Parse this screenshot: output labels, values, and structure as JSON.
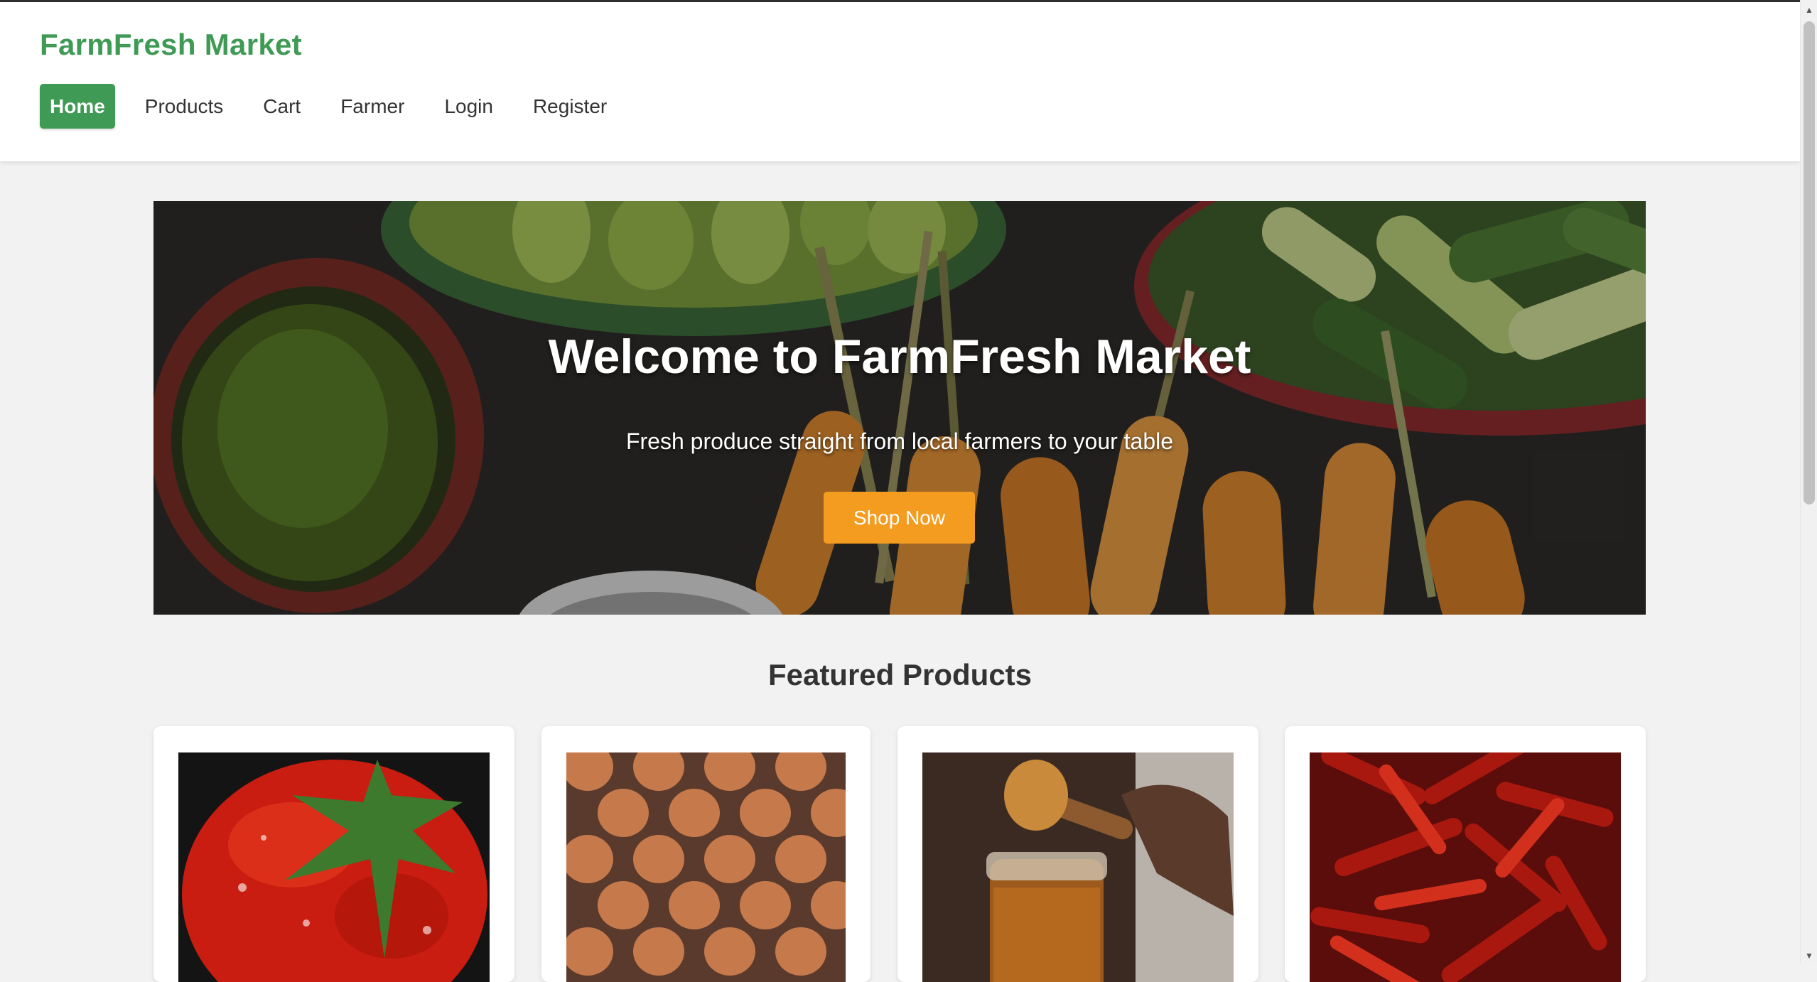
{
  "brand": {
    "name": "FarmFresh Market",
    "color": "#3f9a55"
  },
  "nav": {
    "items": [
      {
        "label": "Home",
        "active": true
      },
      {
        "label": "Products",
        "active": false
      },
      {
        "label": "Cart",
        "active": false
      },
      {
        "label": "Farmer",
        "active": false
      },
      {
        "label": "Login",
        "active": false
      },
      {
        "label": "Register",
        "active": false
      }
    ]
  },
  "hero": {
    "title": "Welcome to FarmFresh Market",
    "subtitle": "Fresh produce straight from local farmers to your table",
    "cta_label": "Shop Now",
    "cta_color": "#f39c1f",
    "image": "vegetables-market-photo"
  },
  "featured": {
    "title": "Featured Products",
    "products": [
      {
        "image": "tomato-photo"
      },
      {
        "image": "eggs-tray-photo"
      },
      {
        "image": "honey-jar-photo"
      },
      {
        "image": "dried-red-chilies-photo"
      }
    ]
  }
}
